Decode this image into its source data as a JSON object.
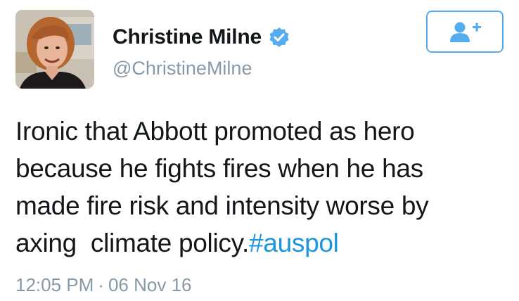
{
  "user": {
    "display_name": "Christine Milne",
    "handle": "@ChristineMilne",
    "verified": true
  },
  "follow_button": {
    "icon": "add-user-icon"
  },
  "tweet": {
    "line1": "Ironic that Abbott promoted as hero",
    "line2": "because he fights fires when he has",
    "line3": "made fire risk and intensity worse by",
    "line4_text": "axing  climate policy.",
    "hashtag": "#auspol"
  },
  "timestamp": {
    "time": "12:05 PM",
    "separator": "·",
    "date": "06 Nov 16"
  },
  "colors": {
    "accent": "#1b95e0",
    "verified": "#55acee",
    "secondary_text": "#8899a6",
    "primary_text": "#14171a"
  }
}
